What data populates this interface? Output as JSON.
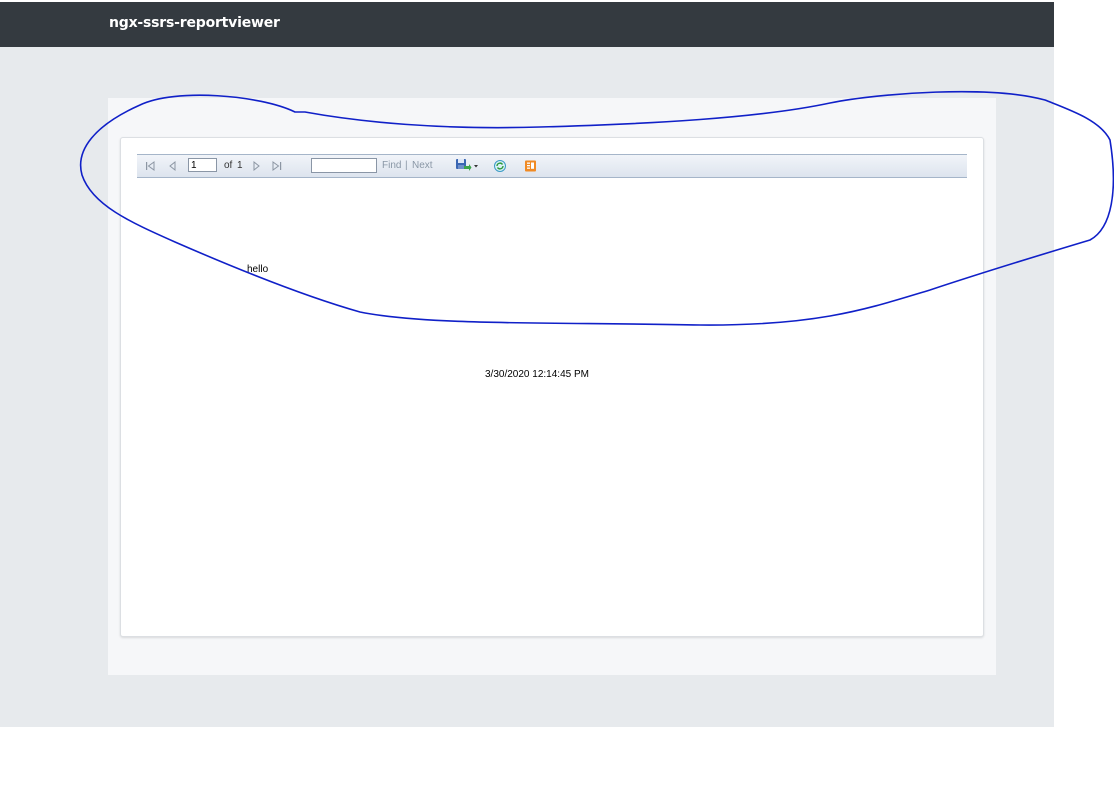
{
  "navbar": {
    "brand": "ngx-ssrs-reportviewer"
  },
  "toolbar": {
    "first_page_icon": "first-page-icon",
    "prev_page_icon": "previous-page-icon",
    "page_value": "1",
    "of_label": "of",
    "total_pages": "1",
    "next_page_icon": "next-page-icon",
    "last_page_icon": "last-page-icon",
    "find_value": "",
    "find_label": "Find",
    "separator": "|",
    "next_label": "Next",
    "export_icon": "save-export-icon",
    "refresh_icon": "refresh-icon",
    "print_icon": "document-icon"
  },
  "report": {
    "text": "hello",
    "timestamp": "3/30/2020 12:14:45 PM"
  },
  "colors": {
    "navbar_bg": "#343a40",
    "annotation_stroke": "#1020c8"
  }
}
